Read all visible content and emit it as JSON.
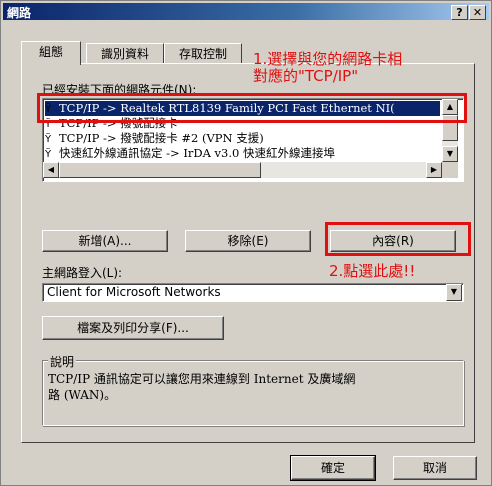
{
  "window": {
    "title": "網路",
    "help_label": "?",
    "close_label": "✕"
  },
  "tabs": [
    {
      "label": "組態"
    },
    {
      "label": "識別資料"
    },
    {
      "label": "存取控制"
    }
  ],
  "components": {
    "label": "已經安裝下面的網路元件(N):",
    "items": [
      {
        "icon": "network-protocol-icon",
        "label": "TCP/IP -> Realtek RTL8139 Family PCI Fast Ethernet NI("
      },
      {
        "icon": "network-protocol-icon",
        "label": "TCP/IP -> 撥號配接卡"
      },
      {
        "icon": "network-protocol-icon",
        "label": "TCP/IP -> 撥號配接卡 #2 (VPN 支援)"
      },
      {
        "icon": "network-protocol-icon",
        "label": "快速紅外線通訊協定 -> IrDA v3.0 快速紅外線連接埠"
      }
    ],
    "selected_index": 0
  },
  "buttons": {
    "add": "新增(A)...",
    "remove": "移除(E)",
    "properties": "內容(R)",
    "file_print_sharing": "檔案及列印分享(F)...",
    "ok": "確定",
    "cancel": "取消"
  },
  "primary_logon": {
    "label": "主網路登入(L):",
    "value": "Client for Microsoft Networks"
  },
  "description": {
    "title": "說明",
    "text_line1": "TCP/IP 通訊協定可以讓您用來連線到 Internet 及廣域網",
    "text_line2": "路 (WAN)。"
  },
  "annotations": {
    "step1_line1": "1.選擇與您的網路卡相",
    "step1_line2": "對應的\"TCP/IP\"",
    "step2": "2.點選此處!!",
    "color": "#e01010"
  }
}
